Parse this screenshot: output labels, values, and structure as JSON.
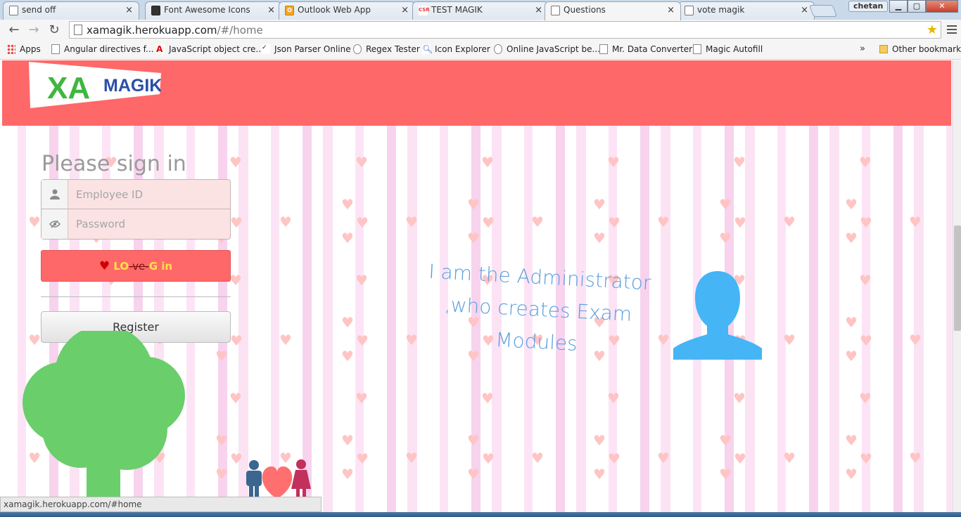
{
  "browser": {
    "tabs": [
      {
        "title": "send off",
        "icon": "page-icon",
        "active": false
      },
      {
        "title": "Font Awesome Icons",
        "icon": "fontawesome-icon",
        "active": false
      },
      {
        "title": "Outlook Web App",
        "icon": "outlook-icon",
        "active": false
      },
      {
        "title": "TEST MAGIK",
        "icon": "csr-icon",
        "active": false
      },
      {
        "title": "Questions",
        "icon": "page-icon",
        "active": true
      },
      {
        "title": "vote magik",
        "icon": "page-icon",
        "active": false
      }
    ],
    "user": "chetan",
    "address": {
      "host": "xamagik.herokuapp.com",
      "path": "/#/home"
    },
    "bookmarks": [
      {
        "label": "Apps",
        "icon": "apps-icon"
      },
      {
        "label": "Angular directives f...",
        "icon": "page-icon"
      },
      {
        "label": "JavaScript object cre...",
        "icon": "pdf-icon"
      },
      {
        "label": "Json Parser Online",
        "icon": "json-icon"
      },
      {
        "label": "Regex Tester",
        "icon": "regex-icon"
      },
      {
        "label": "Icon Explorer",
        "icon": "search-icon"
      },
      {
        "label": "Online JavaScript be...",
        "icon": "octocat-icon"
      },
      {
        "label": "Mr. Data Converter",
        "icon": "page-icon"
      },
      {
        "label": "Magic Autofill",
        "icon": "page-icon"
      }
    ],
    "bookmarks_more": "»",
    "other_bookmarks": "Other bookmarks",
    "status_url": "xamagik.herokuapp.com/#home"
  },
  "page": {
    "logo": {
      "xa": "XA",
      "magik": "MAGIK"
    },
    "signin_title": "Please sign in",
    "employee_id_placeholder": "Employee ID",
    "password_placeholder": "Password",
    "login": {
      "lo": "LO",
      "ve": "-ve-",
      "g": "G",
      "in": "in"
    },
    "register_label": "Register",
    "tagline_lines": [
      "I am the Administrator",
      ",who creates Exam",
      "Modules"
    ]
  },
  "colors": {
    "header": "#ff6868",
    "login_button": "#ff6868",
    "tagline": "#5a9fde",
    "avatar": "#45b5f5",
    "tree": "#6ace6a",
    "hearts": "#ffc4c4"
  }
}
